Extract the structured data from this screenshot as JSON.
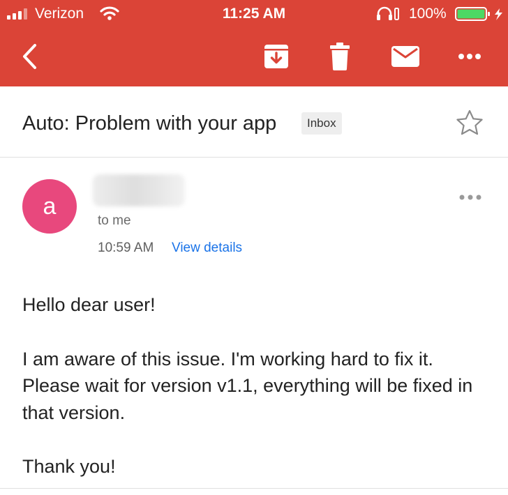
{
  "status_bar": {
    "carrier": "Verizon",
    "time": "11:25 AM",
    "battery_percent": "100%",
    "battery_level": 1.0
  },
  "toolbar": {
    "icons": [
      "back-arrow-icon",
      "archive-icon",
      "trash-icon",
      "mail-icon",
      "more-horizontal-icon"
    ],
    "color": "#db4437"
  },
  "email": {
    "subject": "Auto: Problem with your app",
    "label": "Inbox",
    "sender": {
      "avatar_letter": "a",
      "avatar_color": "#e8487d",
      "recipient": "to me",
      "time": "10:59 AM",
      "details_link": "View details"
    },
    "body": {
      "greeting": "Hello dear user!",
      "paragraph": "I am aware of this issue. I'm working hard to fix it. Please wait for version v1.1, everything will be fixed in that version.",
      "closing": "Thank you!"
    }
  },
  "colors": {
    "header": "#db4437",
    "link": "#1a73e8",
    "avatar": "#e8487d"
  }
}
